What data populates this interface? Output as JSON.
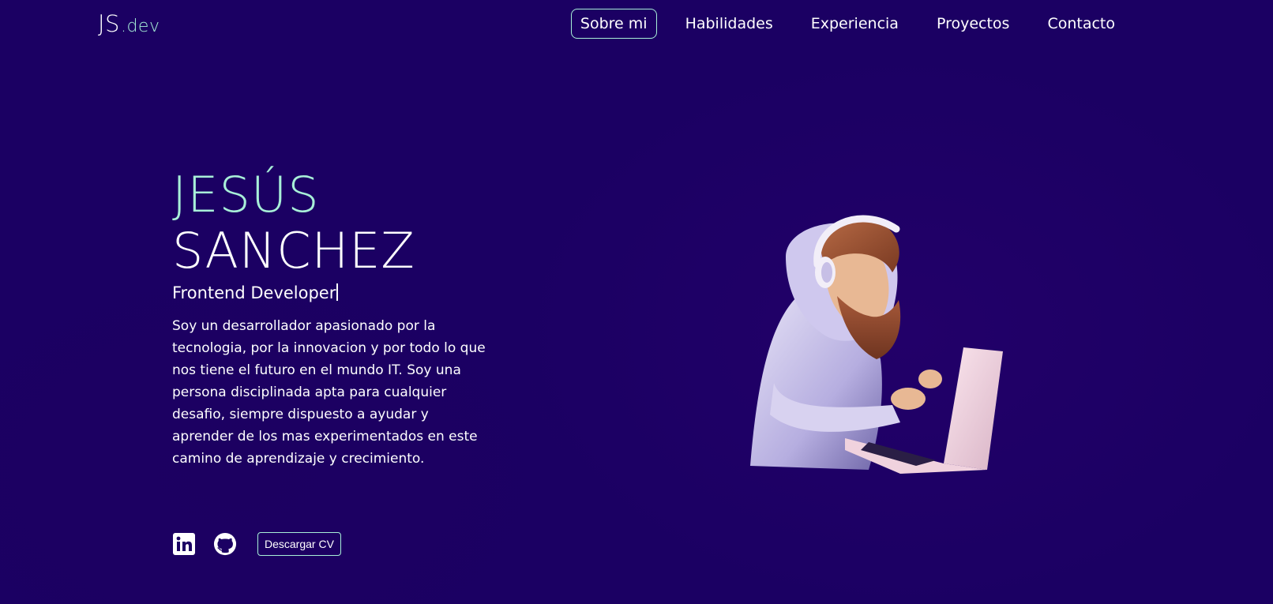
{
  "logo": {
    "main": "JS",
    "suffix": ".dev"
  },
  "nav": {
    "items": [
      {
        "label": "Sobre mi",
        "active": true
      },
      {
        "label": "Habilidades",
        "active": false
      },
      {
        "label": "Experiencia",
        "active": false
      },
      {
        "label": "Proyectos",
        "active": false
      },
      {
        "label": "Contacto",
        "active": false
      }
    ]
  },
  "hero": {
    "first_name": "JESÚS",
    "last_name": "SANCHEZ",
    "role": "Frontend Developer",
    "bio": "Soy un desarrollador apasionado por la tecnologia, por la innovacion y por todo lo que nos tiene el futuro en el mundo IT. Soy una persona disciplinada apta para cualquier desafio, siempre dispuesto a ayudar y aprender de los mas experimentados en este camino de aprendizaje y crecimiento.",
    "cv_button": "Descargar CV"
  },
  "icons": {
    "linkedin": "linkedin-icon",
    "github": "github-icon"
  },
  "colors": {
    "background": "#1b0063",
    "accent": "#a8f0d8",
    "text": "#ffffff"
  }
}
